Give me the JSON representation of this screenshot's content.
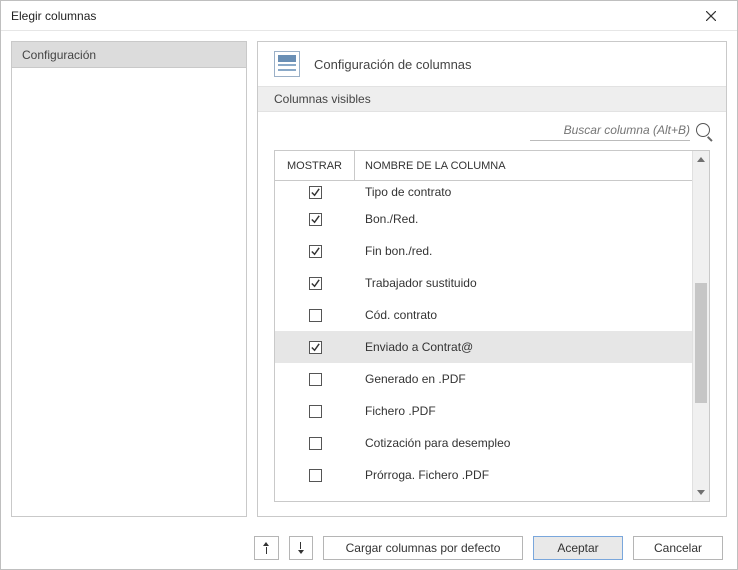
{
  "window": {
    "title": "Elegir columnas"
  },
  "sidebar": {
    "items": [
      {
        "label": "Configuración"
      }
    ]
  },
  "panel": {
    "title": "Configuración de columnas",
    "section_label": "Columnas visibles"
  },
  "search": {
    "placeholder": "Buscar columna (Alt+B)"
  },
  "table": {
    "headers": {
      "show": "MOSTRAR",
      "name": "NOMBRE DE LA COLUMNA"
    },
    "rows": [
      {
        "checked": true,
        "name": "Tipo de contrato",
        "partial": true
      },
      {
        "checked": true,
        "name": "Bon./Red."
      },
      {
        "checked": true,
        "name": "Fin bon./red."
      },
      {
        "checked": true,
        "name": "Trabajador sustituido"
      },
      {
        "checked": false,
        "name": "Cód. contrato"
      },
      {
        "checked": true,
        "name": "Enviado a Contrat@",
        "selected": true
      },
      {
        "checked": false,
        "name": "Generado en .PDF"
      },
      {
        "checked": false,
        "name": "Fichero .PDF"
      },
      {
        "checked": false,
        "name": "Cotización para desempleo"
      },
      {
        "checked": false,
        "name": "Prórroga. Fichero .PDF"
      }
    ]
  },
  "footer": {
    "load_default": "Cargar columnas por defecto",
    "accept": "Aceptar",
    "cancel": "Cancelar"
  }
}
